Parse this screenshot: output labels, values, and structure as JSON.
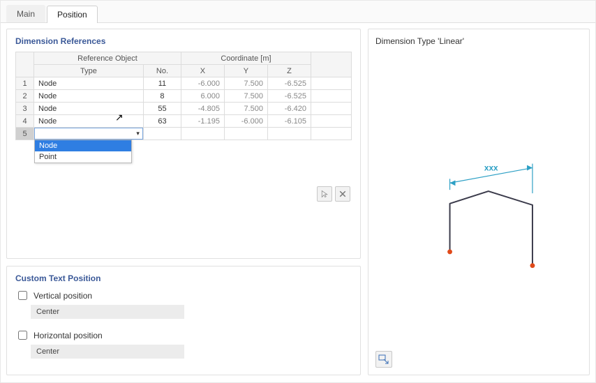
{
  "tabs": {
    "main": "Main",
    "position": "Position"
  },
  "dim_refs": {
    "title": "Dimension References",
    "headers": {
      "ref_object": "Reference Object",
      "coordinate": "Coordinate [m]",
      "type": "Type",
      "no": "No.",
      "x": "X",
      "y": "Y",
      "z": "Z"
    },
    "rows": [
      {
        "idx": "1",
        "type": "Node",
        "no": "11",
        "x": "-6.000",
        "y": "7.500",
        "z": "-6.525"
      },
      {
        "idx": "2",
        "type": "Node",
        "no": "8",
        "x": "6.000",
        "y": "7.500",
        "z": "-6.525"
      },
      {
        "idx": "3",
        "type": "Node",
        "no": "55",
        "x": "-4.805",
        "y": "7.500",
        "z": "-6.420"
      },
      {
        "idx": "4",
        "type": "Node",
        "no": "63",
        "x": "-1.195",
        "y": "-6.000",
        "z": "-6.105"
      }
    ],
    "new_row_idx": "5",
    "dropdown_options": [
      "Node",
      "Point"
    ],
    "dropdown_selected": "Node"
  },
  "custom_pos": {
    "title": "Custom Text Position",
    "vertical_label": "Vertical position",
    "vertical_value": "Center",
    "horizontal_label": "Horizontal position",
    "horizontal_value": "Center"
  },
  "preview": {
    "title": "Dimension Type 'Linear'",
    "dim_label": "xxx"
  }
}
